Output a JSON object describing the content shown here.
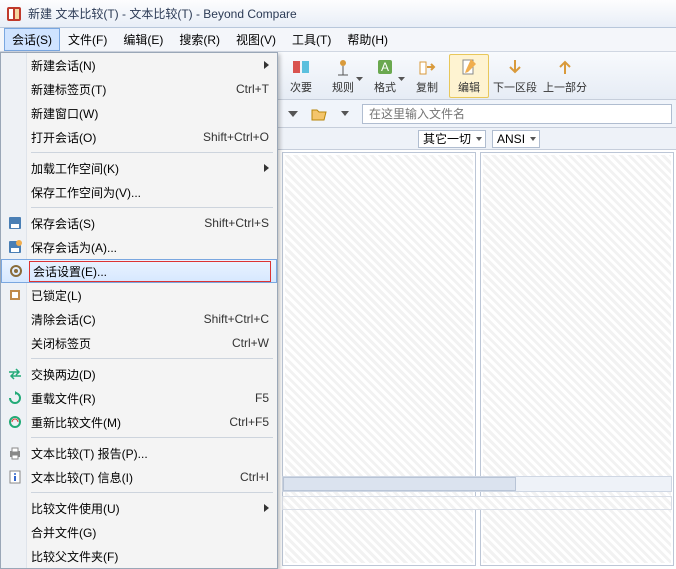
{
  "title": "新建 文本比较(T) - 文本比较(T) - Beyond Compare",
  "menubar": [
    "会话(S)",
    "文件(F)",
    "编辑(E)",
    "搜索(R)",
    "视图(V)",
    "工具(T)",
    "帮助(H)"
  ],
  "toolbar": [
    {
      "label": "次要",
      "icon": "diff",
      "drop": false
    },
    {
      "label": "规则",
      "icon": "rules",
      "drop": true
    },
    {
      "label": "格式",
      "icon": "format",
      "drop": true
    },
    {
      "label": "复制",
      "icon": "copy",
      "drop": false
    },
    {
      "label": "编辑",
      "icon": "edit",
      "drop": false,
      "hilite": true
    },
    {
      "label": "下一区段",
      "icon": "down",
      "drop": false
    },
    {
      "label": "上一部分",
      "icon": "up",
      "drop": false
    }
  ],
  "pathbar": {
    "placeholder": "在这里输入文件名"
  },
  "filterbar": {
    "sel1": "其它一切",
    "sel2": "ANSI"
  },
  "menu": {
    "groups": [
      [
        {
          "label": "新建会话(N)",
          "shortcut": "",
          "arrow": true
        },
        {
          "label": "新建标签页(T)",
          "shortcut": "Ctrl+T"
        },
        {
          "label": "新建窗口(W)",
          "shortcut": ""
        },
        {
          "label": "打开会话(O)",
          "shortcut": "Shift+Ctrl+O"
        }
      ],
      [
        {
          "label": "加载工作空间(K)",
          "shortcut": "",
          "arrow": true
        },
        {
          "label": "保存工作空间为(V)...",
          "shortcut": ""
        }
      ],
      [
        {
          "label": "保存会话(S)",
          "shortcut": "Shift+Ctrl+S",
          "icon": "save"
        },
        {
          "label": "保存会话为(A)...",
          "shortcut": "",
          "icon": "saveas"
        },
        {
          "label": "会话设置(E)...",
          "shortcut": "",
          "icon": "gear",
          "hover": true,
          "red": true
        },
        {
          "label": "已锁定(L)",
          "shortcut": "",
          "icon": "lock"
        },
        {
          "label": "清除会话(C)",
          "shortcut": "Shift+Ctrl+C"
        },
        {
          "label": "关闭标签页",
          "shortcut": "Ctrl+W"
        }
      ],
      [
        {
          "label": "交换两边(D)",
          "shortcut": "",
          "icon": "swap"
        },
        {
          "label": "重载文件(R)",
          "shortcut": "F5",
          "icon": "reload"
        },
        {
          "label": "重新比较文件(M)",
          "shortcut": "Ctrl+F5",
          "icon": "recompare"
        }
      ],
      [
        {
          "label": "文本比较(T) 报告(P)...",
          "shortcut": "",
          "icon": "print"
        },
        {
          "label": "文本比较(T) 信息(I)",
          "shortcut": "Ctrl+I",
          "icon": "info"
        }
      ],
      [
        {
          "label": "比较文件使用(U)",
          "shortcut": "",
          "arrow": true
        },
        {
          "label": "合并文件(G)",
          "shortcut": ""
        },
        {
          "label": "比较父文件夹(F)",
          "shortcut": ""
        }
      ]
    ]
  }
}
